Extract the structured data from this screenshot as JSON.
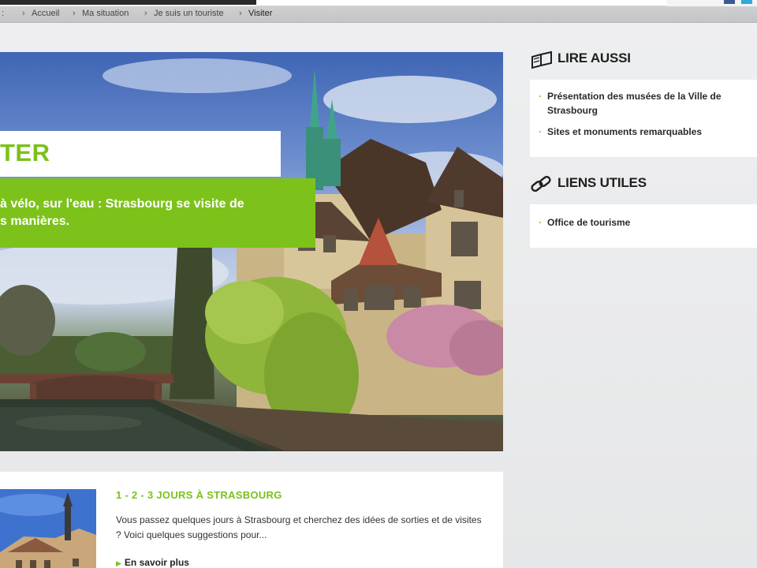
{
  "breadcrumb": {
    "prefix": ":",
    "items": [
      {
        "label": "Accueil"
      },
      {
        "label": "Ma situation"
      },
      {
        "label": "Je suis un touriste"
      },
      {
        "label": "Visiter"
      }
    ]
  },
  "hero": {
    "title": "TER",
    "subtitle": "à vélo, sur l'eau : Strasbourg se visite de\ns manières."
  },
  "article": {
    "title": "1 - 2 - 3 JOURS À STRASBOURG",
    "text": "Vous passez quelques jours à Strasbourg et cherchez des idées de sorties et de visites ? Voici quelques suggestions pour...",
    "more_label": "En savoir plus"
  },
  "sidebar": {
    "lire_aussi": {
      "heading": "LIRE AUSSI",
      "icon": "open-book-icon",
      "links": [
        {
          "label": "Présentation des musées de la Ville de Strasbourg"
        },
        {
          "label": "Sites et monuments remarquables"
        }
      ]
    },
    "liens_utiles": {
      "heading": "LIENS UTILES",
      "icon": "chain-link-icon",
      "links": [
        {
          "label": "Office de tourisme"
        }
      ]
    }
  },
  "colors": {
    "accent_green": "#7cc21b",
    "breadcrumb_bg": "#c8c9cb",
    "page_bg": "#e9eaeb"
  }
}
